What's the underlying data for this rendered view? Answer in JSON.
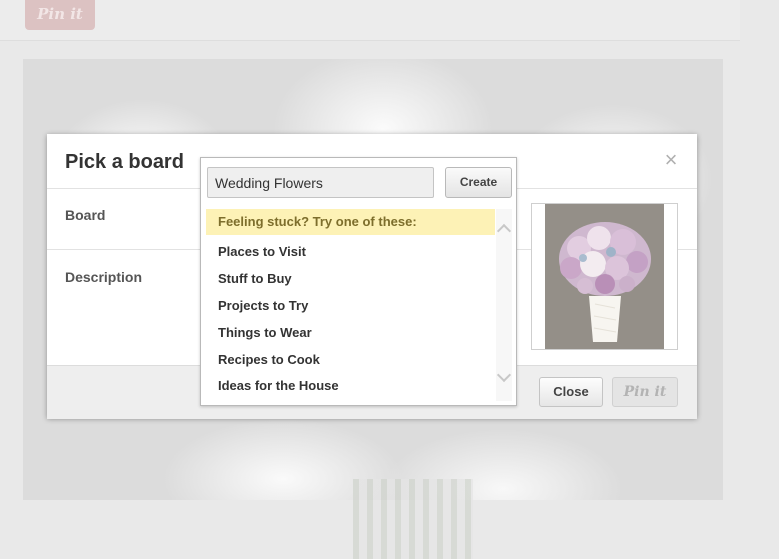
{
  "background": {
    "pin_it_label": "Pin it"
  },
  "modal": {
    "title": "Pick a board",
    "close_icon": "close-icon",
    "board_label": "Board",
    "description_label": "Description",
    "close_button": "Close",
    "pin_it_button": "Pin it"
  },
  "dropdown": {
    "board_name_value": "Wedding Flowers",
    "create_button": "Create",
    "suggestion_header": "Feeling stuck? Try one of these:",
    "suggestions": [
      "Places to Visit",
      "Stuff to Buy",
      "Projects to Try",
      "Things to Wear",
      "Recipes to Cook",
      "Ideas for the House"
    ]
  },
  "colors": {
    "suggestion_highlight": "#fdf2b6",
    "modal_footer": "#eeeeee"
  }
}
